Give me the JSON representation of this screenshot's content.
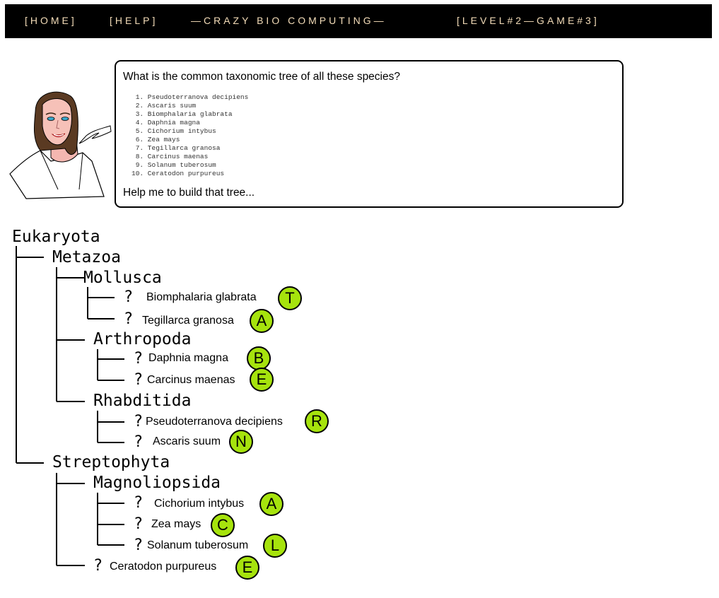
{
  "nav": {
    "home": "[HOME]",
    "help": "[HELP]",
    "title": "—CRAZY BIO COMPUTING—",
    "level": "[LEVEL#2—GAME#3]"
  },
  "bubble": {
    "question": "What is the common taxonomic tree of all these species?",
    "species": [
      " 1. Pseudoterranova decipiens",
      " 2. Ascaris suum",
      " 3. Biomphalaria glabrata",
      " 4. Daphnia magna",
      " 5. Cichorium intybus",
      " 6. Zea mays",
      " 7. Tegillarca granosa",
      " 8. Carcinus maenas",
      " 9. Solanum tuberosum",
      "10. Ceratodon purpureus"
    ],
    "help": "Help me to build that tree..."
  },
  "tree": {
    "root": "Eukaryota",
    "metazoa": "Metazoa",
    "mollusca": "Mollusca",
    "arthropoda": "Arthropoda",
    "rhabditida": "Rhabditida",
    "streptophyta": "Streptophyta",
    "magnoliopsida": "Magnoliopsida",
    "unknown_mark": "?",
    "leaves": [
      {
        "name": "Biomphalaria glabrata",
        "letter": "T"
      },
      {
        "name": "Tegillarca granosa",
        "letter": "A"
      },
      {
        "name": "Daphnia magna",
        "letter": "B"
      },
      {
        "name": "Carcinus maenas",
        "letter": "E"
      },
      {
        "name": "Pseudoterranova decipiens",
        "letter": "R"
      },
      {
        "name": "Ascaris suum",
        "letter": "N"
      },
      {
        "name": "Cichorium intybus",
        "letter": "A"
      },
      {
        "name": "Zea mays",
        "letter": "C"
      },
      {
        "name": "Solanum tuberosum",
        "letter": "L"
      },
      {
        "name": "Ceratodon purpureus",
        "letter": "E"
      }
    ]
  },
  "colors": {
    "nav_bg": "#000000",
    "nav_text": "#f3dcb8",
    "letter_circle": "#a6e30d"
  }
}
